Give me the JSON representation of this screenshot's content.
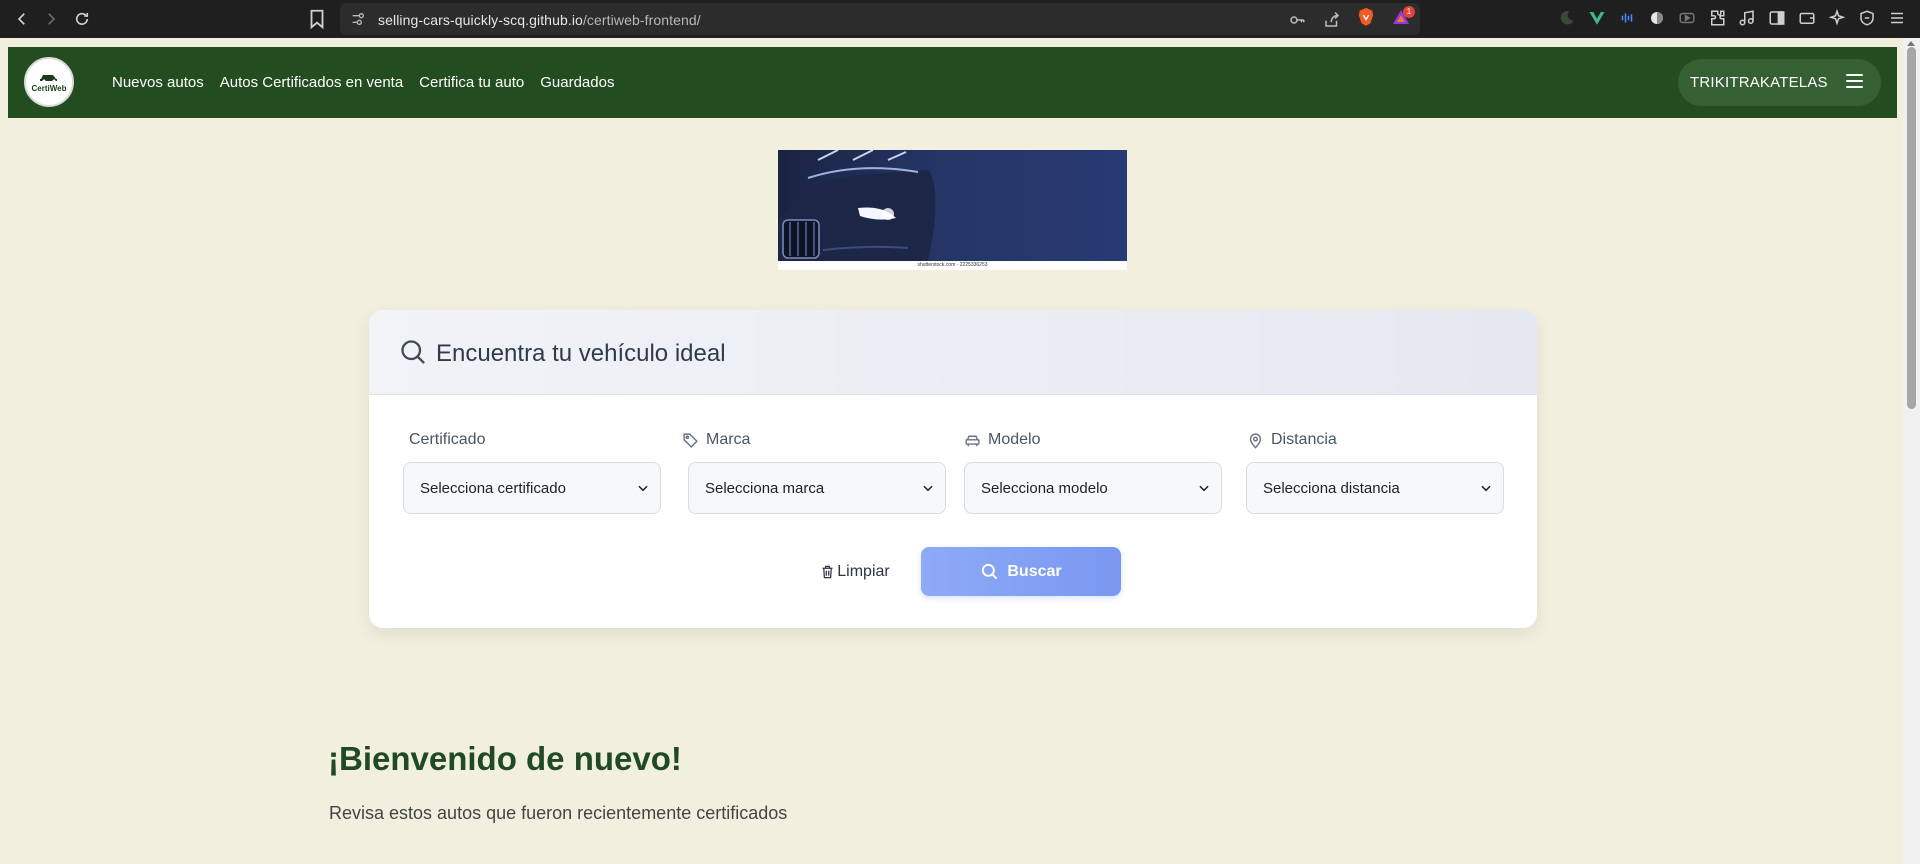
{
  "browser": {
    "url_host": "selling-cars-quickly-scq.github.io",
    "url_path": "/certiweb-frontend/",
    "rewards_count": "1"
  },
  "site": {
    "logo_text": "CertiWeb",
    "nav": [
      "Nuevos autos",
      "Autos Certificados en venta",
      "Certifica tu auto",
      "Guardados"
    ],
    "user_name": "TRIKITRAKATELAS"
  },
  "banner": {
    "caption": "shutterstock.com · 2225336253"
  },
  "search": {
    "title": "Encuentra tu vehículo ideal",
    "filters": [
      {
        "label": "Certificado",
        "placeholder": "Selecciona certificado",
        "icon": "none"
      },
      {
        "label": "Marca",
        "placeholder": "Selecciona marca",
        "icon": "tag-icon"
      },
      {
        "label": "Modelo",
        "placeholder": "Selecciona modelo",
        "icon": "car-icon"
      },
      {
        "label": "Distancia",
        "placeholder": "Selecciona distancia",
        "icon": "location-pin-icon"
      }
    ],
    "clear_label": "Limpiar",
    "search_label": "Buscar"
  },
  "welcome": {
    "title": "¡Bienvenido de nuevo!",
    "subtitle": "Revisa estos autos que fueron recientemente certificados"
  },
  "colors": {
    "page_bg": "#f3efdf",
    "header_green": "#234d21",
    "search_button": "#7a97f0"
  }
}
